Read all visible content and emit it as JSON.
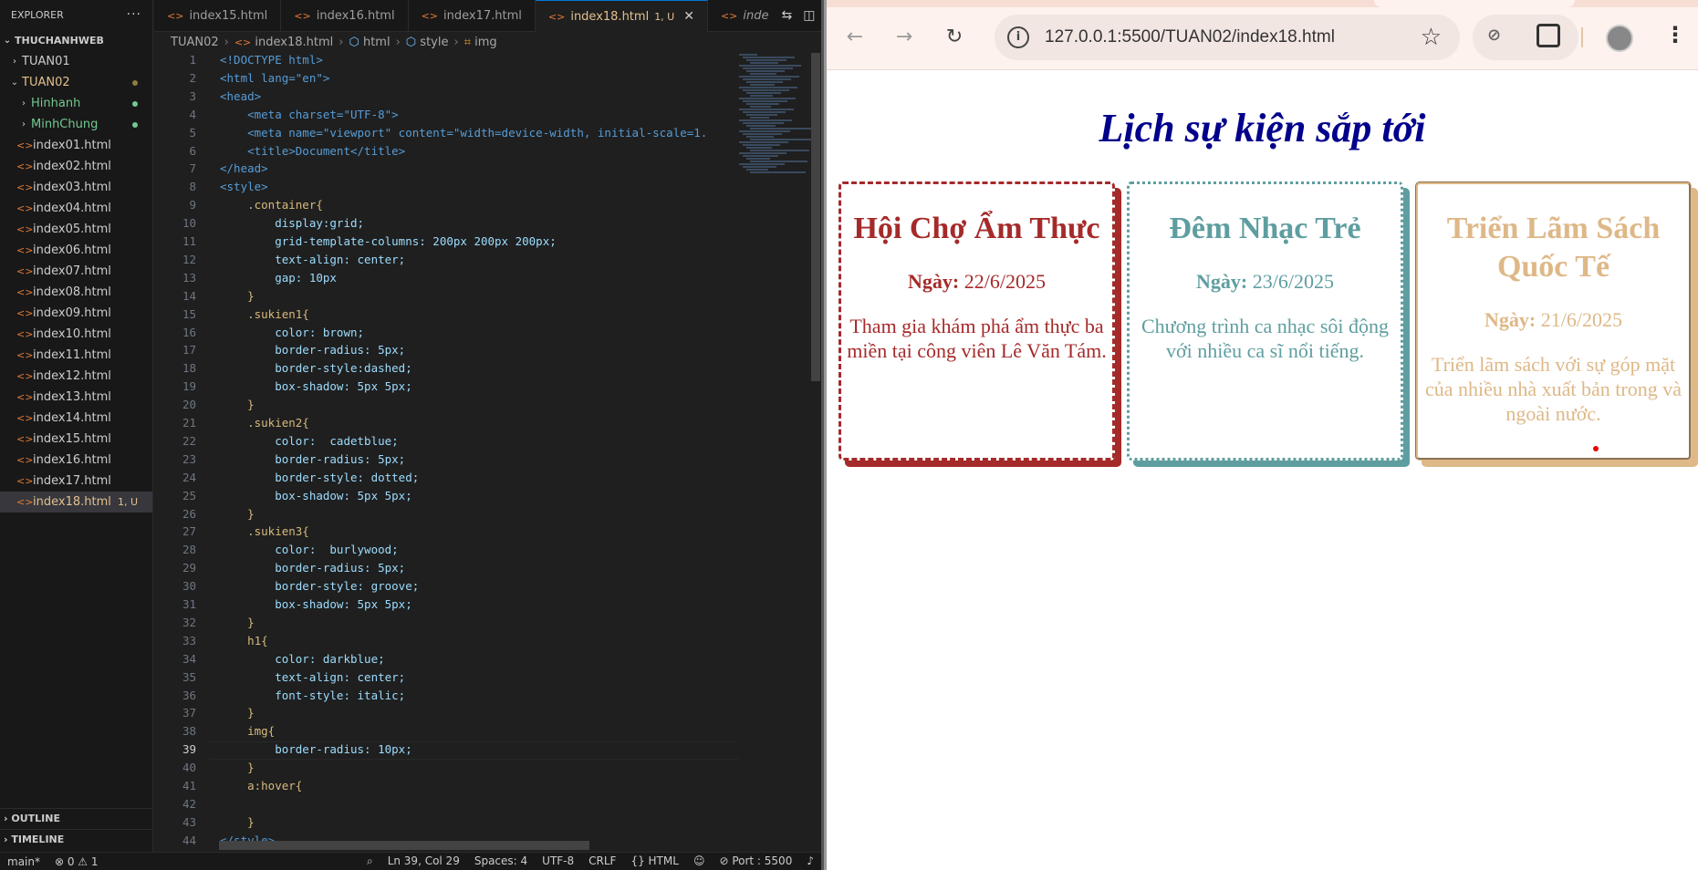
{
  "vscode": {
    "explorer_title": "EXPLORER",
    "workspace": "THUCHANHWEB",
    "folders": {
      "tuan01": "TUAN01",
      "tuan02": "TUAN02",
      "hinhanh": "Hinhanh",
      "minhchung": "MinhChung"
    },
    "files": [
      "index01.html",
      "index02.html",
      "index03.html",
      "index04.html",
      "index05.html",
      "index06.html",
      "index07.html",
      "index08.html",
      "index09.html",
      "index10.html",
      "index11.html",
      "index12.html",
      "index13.html",
      "index14.html",
      "index15.html",
      "index16.html",
      "index17.html",
      "index18.html"
    ],
    "active_file_badge": "1, U",
    "outline": "OUTLINE",
    "timeline": "TIMELINE",
    "tabs": [
      "index15.html",
      "index16.html",
      "index17.html",
      "index18.html",
      "inde"
    ],
    "active_tab_status": "1, U",
    "breadcrumb": [
      "TUAN02",
      "index18.html",
      "html",
      "style",
      "img"
    ],
    "code_lines": [
      "<!DOCTYPE html>",
      "<html lang=\"en\">",
      "<head>",
      "    <meta charset=\"UTF-8\">",
      "    <meta name=\"viewport\" content=\"width=device-width, initial-scale=1.",
      "    <title>Document</title>",
      "</head>",
      "<style>",
      "    .container{",
      "        display:grid;",
      "        grid-template-columns: 200px 200px 200px;",
      "        text-align: center;",
      "        gap: 10px",
      "    }",
      "    .sukien1{",
      "        color: brown;",
      "        border-radius: 5px;",
      "        border-style:dashed;",
      "        box-shadow: 5px 5px;",
      "    }",
      "    .sukien2{",
      "        color:  cadetblue;",
      "        border-radius: 5px;",
      "        border-style: dotted;",
      "        box-shadow: 5px 5px;",
      "    }",
      "    .sukien3{",
      "        color:  burlywood;",
      "        border-radius: 5px;",
      "        border-style: groove;",
      "        box-shadow: 5px 5px;",
      "    }",
      "    h1{",
      "        color: darkblue;",
      "        text-align: center;",
      "        font-style: italic;",
      "    }",
      "    img{",
      "        border-radius: 10px;",
      "    }",
      "    a:hover{",
      "",
      "    }",
      "</style>"
    ],
    "status": {
      "branch": "main*",
      "problems": "⊗ 0 ⚠ 1",
      "cursor": "Ln 39, Col 29",
      "spaces": "Spaces: 4",
      "encoding": "UTF-8",
      "eol": "CRLF",
      "language": "{} HTML",
      "port": "⊘ Port : 5500"
    }
  },
  "browser": {
    "url": "127.0.0.1:5500/TUAN02/index18.html",
    "heading": "Lịch sự kiện sắp tới",
    "cards": [
      {
        "title": "Hội Chợ Ẩm Thực",
        "date_label": "Ngày:",
        "date": " 22/6/2025",
        "desc": "Tham gia khám phá ẩm thực ba miền tại công viên Lê Văn Tám.",
        "color": "#a52a2a"
      },
      {
        "title": "Đêm Nhạc Trẻ",
        "date_label": "Ngày:",
        "date": " 23/6/2025",
        "desc": "Chương trình ca nhạc sôi động với nhiều ca sĩ nổi tiếng.",
        "color": "#5f9ea0"
      },
      {
        "title": "Triển Lãm Sách Quốc Tế",
        "date_label": "Ngày:",
        "date": " 21/6/2025",
        "desc": "Triển lãm sách với sự góp mặt của nhiều nhà xuất bản trong và ngoài nước.",
        "color": "#deb887"
      }
    ]
  }
}
